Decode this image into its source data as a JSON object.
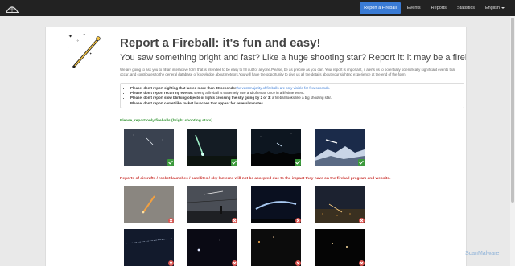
{
  "nav": {
    "logo_icon": "dome-logo-icon",
    "items": [
      {
        "label": "Report a Fireball",
        "active": true
      },
      {
        "label": "Events"
      },
      {
        "label": "Reports"
      },
      {
        "label": "Statistics"
      },
      {
        "label": "English"
      }
    ]
  },
  "header": {
    "title": "Report a Fireball: it's fun and easy!",
    "subtitle": "You saw something bright and fast? Like a huge shooting star? Report it: it may be a fireball.",
    "intro": "We are going to ask you to fill an interactive form that is intended to be easy to fill out for anyone.Please, be as precise as you can. Your report is important, it alerts us to potentially scientifically significant events that occur, and contributes to the general database of knowledge about meteors.You will have the opportunity to give us all the details about your sighting experience at the end of the form."
  },
  "rules": [
    {
      "bold": "Please, don't report sighting that lasted more than 30 seconds:",
      "link": "the vast majority of fireballs are only visible for few seconds.",
      "rest": ""
    },
    {
      "bold": "Please, don't report recurring events:",
      "link": "",
      "rest": " seeing a fireball is extremely rare and often an once in a lifetime event."
    },
    {
      "bold": "Please, don't report slow blinking objects or lights crossing the sky going by 2 or 3:",
      "link": "",
      "rest": " a fireball looks like a big shooting star."
    },
    {
      "bold": "Please, don't report comet-like rocket launches that appear for several minutes",
      "link": "",
      "rest": ""
    }
  ],
  "valid_section": {
    "label": "Please, report only fireballs (bright shooting stars).",
    "status_color": "#3c9a3c",
    "badge_icon": "checkmark-icon"
  },
  "invalid_section": {
    "label": "Reports of aircrafts / rocket launches / satellites / sky lanterns will not be accepted due to the impact they have on the fireball program and website.",
    "status_color": "#c9302c",
    "badge_icon": "cross-icon"
  },
  "watermark": "ScanMalware"
}
